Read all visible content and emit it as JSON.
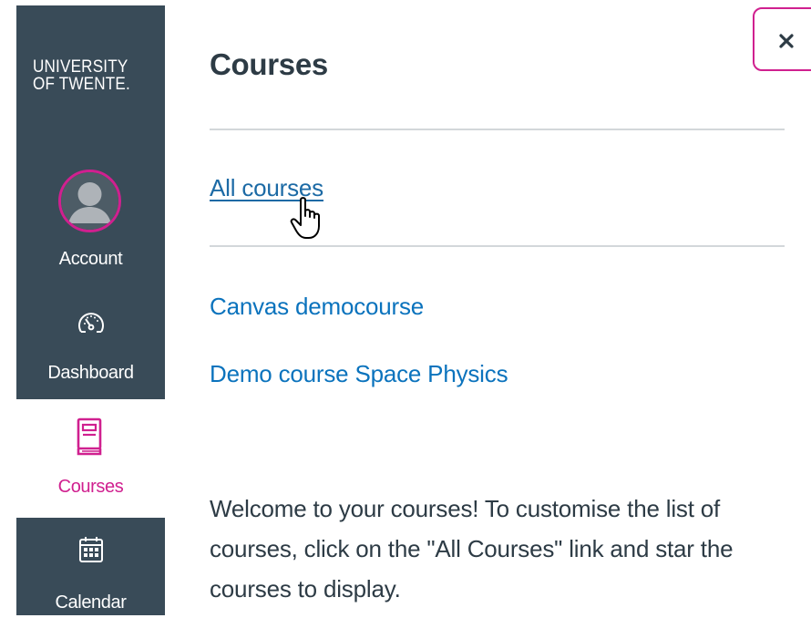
{
  "global_nav": {
    "logo": {
      "line1": "UNIVERSITY",
      "line2": "OF TWENTE."
    },
    "items": [
      {
        "id": "account",
        "label": "Account",
        "icon": "avatar",
        "active": false
      },
      {
        "id": "dashboard",
        "label": "Dashboard",
        "icon": "dashboard-icon",
        "active": false
      },
      {
        "id": "courses",
        "label": "Courses",
        "icon": "courses-book-icon",
        "active": true
      },
      {
        "id": "calendar",
        "label": "Calendar",
        "icon": "calendar-icon",
        "active": false
      }
    ]
  },
  "tray": {
    "title": "Courses",
    "all_courses_link": "All courses",
    "courses": [
      "Canvas democourse",
      "Demo course Space Physics"
    ],
    "welcome_text": "Welcome to your courses! To customise the list of courses, click on the \"All Courses\" link and star the courses to display.",
    "close_icon": "close-icon"
  },
  "colors": {
    "nav_background": "#394b58",
    "accent": "#d0208f",
    "link": "#0b73bd",
    "text": "#2d3b45",
    "divider": "#d3d7da"
  }
}
